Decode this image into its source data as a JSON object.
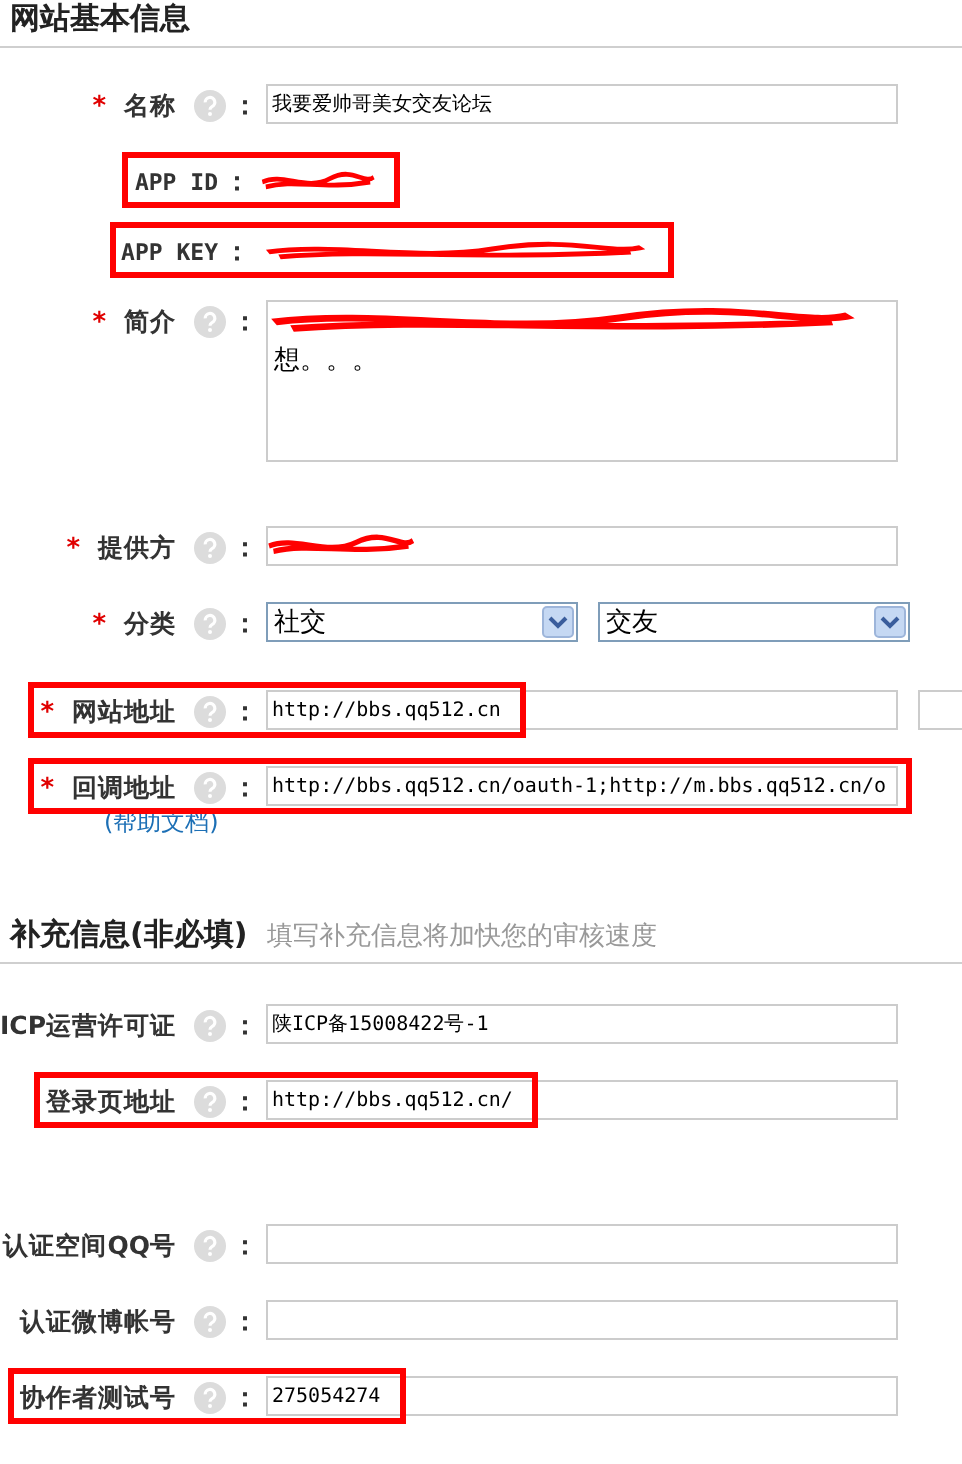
{
  "sections": [
    {
      "title": "网站基本信息",
      "rows": [
        {
          "kind": "text",
          "star": "*",
          "help": true,
          "label": "名称",
          "colon": "：",
          "value": "我要爱帅哥美女交友论坛",
          "highlighted": false,
          "redacted": false
        },
        {
          "kind": "readonly",
          "help": false,
          "label": "APP ID",
          "colon": "：",
          "highlighted": true,
          "redacted": true
        },
        {
          "kind": "readonly",
          "help": false,
          "label": "APP KEY",
          "colon": "：",
          "highlighted": true,
          "redacted": true
        },
        {
          "kind": "textarea",
          "star": "*",
          "help": true,
          "label": "简介",
          "colon": "：",
          "value": "想。。。",
          "highlighted": false,
          "redacted": true
        },
        {
          "kind": "text",
          "star": "*",
          "help": true,
          "label": "提供方",
          "colon": "：",
          "highlighted": false,
          "redacted": true
        },
        {
          "kind": "selects",
          "star": "*",
          "help": true,
          "label": "分类",
          "colon": "：",
          "options": [
            "社交",
            "交友"
          ],
          "highlighted": false
        },
        {
          "kind": "text",
          "star": "*",
          "help": true,
          "label": "网站地址",
          "colon": "：",
          "value": "http://bbs.qq512.cn",
          "extra_field": true,
          "highlighted": true,
          "redacted": false
        },
        {
          "kind": "text",
          "star": "*",
          "help": true,
          "label": "回调地址",
          "colon": "：",
          "value": "http://bbs.qq512.cn/oauth-1;http://m.bbs.qq512.cn/o",
          "link": "(帮助文档)",
          "highlighted": true,
          "redacted": false
        }
      ]
    },
    {
      "title": "补充信息(非必填)",
      "hint": "填写补充信息将加快您的审核速度",
      "rows": [
        {
          "kind": "text",
          "help": true,
          "label": "ICP运营许可证",
          "colon": "：",
          "value": "陕ICP备15008422号-1",
          "highlighted": false,
          "redacted": false
        },
        {
          "kind": "text",
          "help": true,
          "label": "登录页地址",
          "colon": "：",
          "value": "http://bbs.qq512.cn/",
          "highlighted": true,
          "redacted": false
        },
        {
          "kind": "text",
          "help": true,
          "label": "认证空间QQ号",
          "colon": "：",
          "highlighted": false,
          "redacted": false
        },
        {
          "kind": "text",
          "help": true,
          "label": "认证微博帐号",
          "colon": "：",
          "highlighted": false,
          "redacted": false
        },
        {
          "kind": "text",
          "help": true,
          "label": "协作者测试号",
          "colon": "：",
          "value": "275054274",
          "highlighted": true,
          "redacted": false
        }
      ]
    }
  ]
}
